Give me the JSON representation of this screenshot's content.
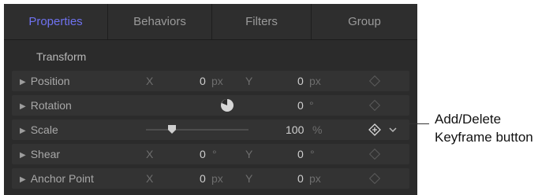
{
  "tabs": [
    {
      "label": "Properties",
      "active": true
    },
    {
      "label": "Behaviors",
      "active": false
    },
    {
      "label": "Filters",
      "active": false
    },
    {
      "label": "Group",
      "active": false
    }
  ],
  "section_title": "Transform",
  "rows": {
    "position": {
      "label": "Position",
      "x_label": "X",
      "x_value": "0",
      "x_unit": "px",
      "y_label": "Y",
      "y_value": "0",
      "y_unit": "px"
    },
    "rotation": {
      "label": "Rotation",
      "value": "0",
      "unit": "°"
    },
    "scale": {
      "label": "Scale",
      "value": "100",
      "unit": "%",
      "slider_fraction": 0.25
    },
    "shear": {
      "label": "Shear",
      "x_label": "X",
      "x_value": "0",
      "x_unit": "°",
      "y_label": "Y",
      "y_value": "0",
      "y_unit": "°"
    },
    "anchor": {
      "label": "Anchor Point",
      "x_label": "X",
      "x_value": "0",
      "x_unit": "px",
      "y_label": "Y",
      "y_value": "0",
      "y_unit": "px"
    }
  },
  "callout": {
    "line1": "Add/Delete",
    "line2": "Keyframe button"
  },
  "colors": {
    "panel": "#2b2b2b",
    "row": "#333333",
    "active_tab": "#6f72f0"
  }
}
